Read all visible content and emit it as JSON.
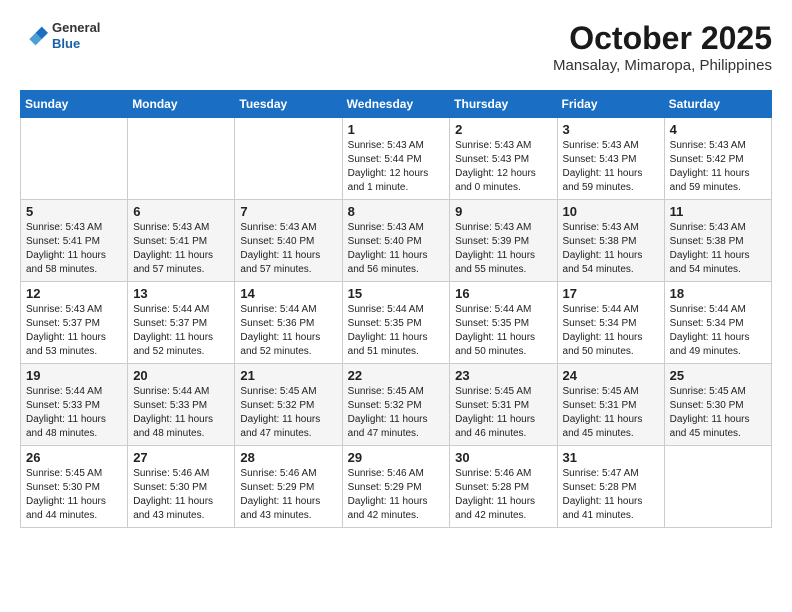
{
  "logo": {
    "general": "General",
    "blue": "Blue"
  },
  "header": {
    "month": "October 2025",
    "location": "Mansalay, Mimaropa, Philippines"
  },
  "weekdays": [
    "Sunday",
    "Monday",
    "Tuesday",
    "Wednesday",
    "Thursday",
    "Friday",
    "Saturday"
  ],
  "weeks": [
    [
      {
        "day": "",
        "info": ""
      },
      {
        "day": "",
        "info": ""
      },
      {
        "day": "",
        "info": ""
      },
      {
        "day": "1",
        "info": "Sunrise: 5:43 AM\nSunset: 5:44 PM\nDaylight: 12 hours\nand 1 minute."
      },
      {
        "day": "2",
        "info": "Sunrise: 5:43 AM\nSunset: 5:43 PM\nDaylight: 12 hours\nand 0 minutes."
      },
      {
        "day": "3",
        "info": "Sunrise: 5:43 AM\nSunset: 5:43 PM\nDaylight: 11 hours\nand 59 minutes."
      },
      {
        "day": "4",
        "info": "Sunrise: 5:43 AM\nSunset: 5:42 PM\nDaylight: 11 hours\nand 59 minutes."
      }
    ],
    [
      {
        "day": "5",
        "info": "Sunrise: 5:43 AM\nSunset: 5:41 PM\nDaylight: 11 hours\nand 58 minutes."
      },
      {
        "day": "6",
        "info": "Sunrise: 5:43 AM\nSunset: 5:41 PM\nDaylight: 11 hours\nand 57 minutes."
      },
      {
        "day": "7",
        "info": "Sunrise: 5:43 AM\nSunset: 5:40 PM\nDaylight: 11 hours\nand 57 minutes."
      },
      {
        "day": "8",
        "info": "Sunrise: 5:43 AM\nSunset: 5:40 PM\nDaylight: 11 hours\nand 56 minutes."
      },
      {
        "day": "9",
        "info": "Sunrise: 5:43 AM\nSunset: 5:39 PM\nDaylight: 11 hours\nand 55 minutes."
      },
      {
        "day": "10",
        "info": "Sunrise: 5:43 AM\nSunset: 5:38 PM\nDaylight: 11 hours\nand 54 minutes."
      },
      {
        "day": "11",
        "info": "Sunrise: 5:43 AM\nSunset: 5:38 PM\nDaylight: 11 hours\nand 54 minutes."
      }
    ],
    [
      {
        "day": "12",
        "info": "Sunrise: 5:43 AM\nSunset: 5:37 PM\nDaylight: 11 hours\nand 53 minutes."
      },
      {
        "day": "13",
        "info": "Sunrise: 5:44 AM\nSunset: 5:37 PM\nDaylight: 11 hours\nand 52 minutes."
      },
      {
        "day": "14",
        "info": "Sunrise: 5:44 AM\nSunset: 5:36 PM\nDaylight: 11 hours\nand 52 minutes."
      },
      {
        "day": "15",
        "info": "Sunrise: 5:44 AM\nSunset: 5:35 PM\nDaylight: 11 hours\nand 51 minutes."
      },
      {
        "day": "16",
        "info": "Sunrise: 5:44 AM\nSunset: 5:35 PM\nDaylight: 11 hours\nand 50 minutes."
      },
      {
        "day": "17",
        "info": "Sunrise: 5:44 AM\nSunset: 5:34 PM\nDaylight: 11 hours\nand 50 minutes."
      },
      {
        "day": "18",
        "info": "Sunrise: 5:44 AM\nSunset: 5:34 PM\nDaylight: 11 hours\nand 49 minutes."
      }
    ],
    [
      {
        "day": "19",
        "info": "Sunrise: 5:44 AM\nSunset: 5:33 PM\nDaylight: 11 hours\nand 48 minutes."
      },
      {
        "day": "20",
        "info": "Sunrise: 5:44 AM\nSunset: 5:33 PM\nDaylight: 11 hours\nand 48 minutes."
      },
      {
        "day": "21",
        "info": "Sunrise: 5:45 AM\nSunset: 5:32 PM\nDaylight: 11 hours\nand 47 minutes."
      },
      {
        "day": "22",
        "info": "Sunrise: 5:45 AM\nSunset: 5:32 PM\nDaylight: 11 hours\nand 47 minutes."
      },
      {
        "day": "23",
        "info": "Sunrise: 5:45 AM\nSunset: 5:31 PM\nDaylight: 11 hours\nand 46 minutes."
      },
      {
        "day": "24",
        "info": "Sunrise: 5:45 AM\nSunset: 5:31 PM\nDaylight: 11 hours\nand 45 minutes."
      },
      {
        "day": "25",
        "info": "Sunrise: 5:45 AM\nSunset: 5:30 PM\nDaylight: 11 hours\nand 45 minutes."
      }
    ],
    [
      {
        "day": "26",
        "info": "Sunrise: 5:45 AM\nSunset: 5:30 PM\nDaylight: 11 hours\nand 44 minutes."
      },
      {
        "day": "27",
        "info": "Sunrise: 5:46 AM\nSunset: 5:30 PM\nDaylight: 11 hours\nand 43 minutes."
      },
      {
        "day": "28",
        "info": "Sunrise: 5:46 AM\nSunset: 5:29 PM\nDaylight: 11 hours\nand 43 minutes."
      },
      {
        "day": "29",
        "info": "Sunrise: 5:46 AM\nSunset: 5:29 PM\nDaylight: 11 hours\nand 42 minutes."
      },
      {
        "day": "30",
        "info": "Sunrise: 5:46 AM\nSunset: 5:28 PM\nDaylight: 11 hours\nand 42 minutes."
      },
      {
        "day": "31",
        "info": "Sunrise: 5:47 AM\nSunset: 5:28 PM\nDaylight: 11 hours\nand 41 minutes."
      },
      {
        "day": "",
        "info": ""
      }
    ]
  ]
}
